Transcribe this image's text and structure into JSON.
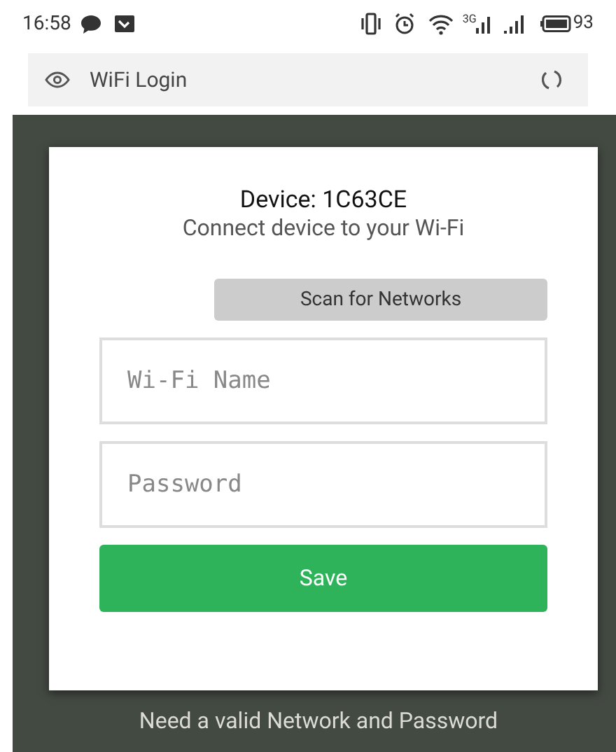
{
  "status_bar": {
    "time": "16:58",
    "network_type": "3G",
    "battery": "93"
  },
  "browser_bar": {
    "title": "WiFi Login"
  },
  "card": {
    "device": "Device: 1C63CE",
    "subtitle": "Connect device to your Wi-Fi",
    "scan_button": "Scan for Networks",
    "fields": [
      {
        "placeholder": "Wi-Fi Name"
      },
      {
        "placeholder": "Password"
      }
    ],
    "save_button": "Save"
  },
  "footer": "Need a valid Network and Password"
}
